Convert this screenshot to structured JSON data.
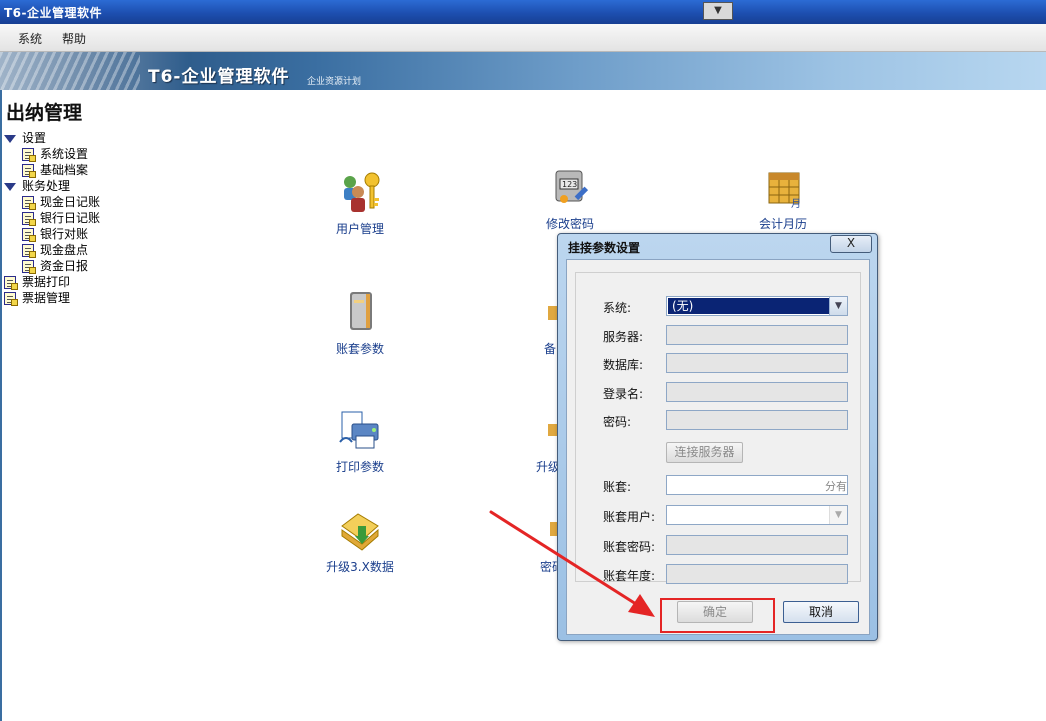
{
  "window": {
    "title": "T6-企业管理软件"
  },
  "menu": {
    "items": [
      "系统",
      "帮助"
    ]
  },
  "banner": {
    "brand": "T6-企业管理软件",
    "subtitle": "企业资源计划"
  },
  "module": {
    "title": "出纳管理"
  },
  "tree": [
    {
      "label": "设置",
      "type": "group"
    },
    {
      "label": "系统设置",
      "type": "item"
    },
    {
      "label": "基础档案",
      "type": "item"
    },
    {
      "label": "账务处理",
      "type": "group"
    },
    {
      "label": "现金日记账",
      "type": "item"
    },
    {
      "label": "银行日记账",
      "type": "item"
    },
    {
      "label": "银行对账",
      "type": "item"
    },
    {
      "label": "现金盘点",
      "type": "item"
    },
    {
      "label": "资金日报",
      "type": "item"
    },
    {
      "label": "票据打印",
      "type": "root-item"
    },
    {
      "label": "票据管理",
      "type": "root-item"
    }
  ],
  "icons": {
    "user_mgmt": "用户管理",
    "change_pwd": "修改密码",
    "calendar": "会计月历",
    "account_params": "账套参数",
    "backup_partial": "备",
    "print_params": "打印参数",
    "upgrade_partial": "升级",
    "upgrade3x": "升级3.X数据",
    "pwd_partial": "密码"
  },
  "dialog": {
    "title": "挂接参数设置",
    "close": "X",
    "labels": {
      "system": "系统:",
      "server": "服务器:",
      "database": "数据库:",
      "login": "登录名:",
      "password": "密码:",
      "account_set": "账套:",
      "account_user": "账套用户:",
      "account_pwd": "账套密码:",
      "account_year": "账套年度:"
    },
    "system_value": "(无)",
    "account_set_hint": "分有",
    "connect_button": "连接服务器",
    "ok_button": "确定",
    "cancel_button": "取消"
  },
  "colors": {
    "title_bar": "#1d4fb0",
    "highlight": "#e42525",
    "link_text": "#1a3e8c"
  }
}
